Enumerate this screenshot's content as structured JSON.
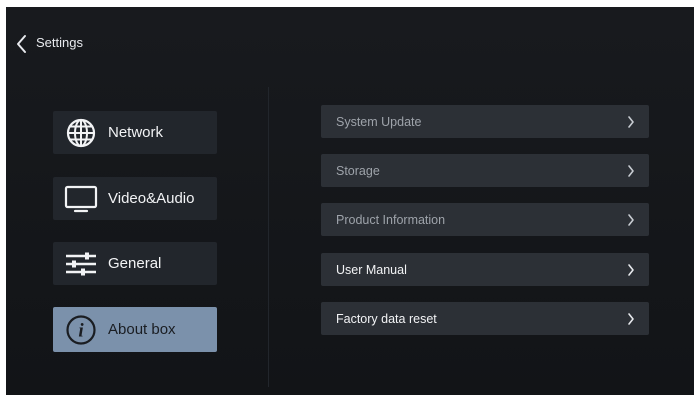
{
  "header": {
    "title": "Settings",
    "back_icon": "chevron-left-icon"
  },
  "sidebar": {
    "items": [
      {
        "label": "Network",
        "icon": "globe-icon",
        "selected": false
      },
      {
        "label": "Video&Audio",
        "icon": "monitor-icon",
        "selected": false
      },
      {
        "label": "General",
        "icon": "sliders-icon",
        "selected": false
      },
      {
        "label": "About box",
        "icon": "info-icon",
        "selected": true
      }
    ]
  },
  "menu": {
    "items": [
      {
        "label": "System Update",
        "icon": "chevron-right-icon"
      },
      {
        "label": "Storage",
        "icon": "chevron-right-icon"
      },
      {
        "label": "Product Information",
        "icon": "chevron-right-icon"
      },
      {
        "label": "User Manual",
        "icon": "chevron-right-icon"
      },
      {
        "label": "Factory data reset",
        "icon": "chevron-right-icon"
      }
    ]
  },
  "colors": {
    "background": "#15171a",
    "panel": "#22262c",
    "row": "#2c3036",
    "selected": "#7b91ab",
    "text": "#f2f3f5",
    "muted_text": "#9ea3aa"
  }
}
